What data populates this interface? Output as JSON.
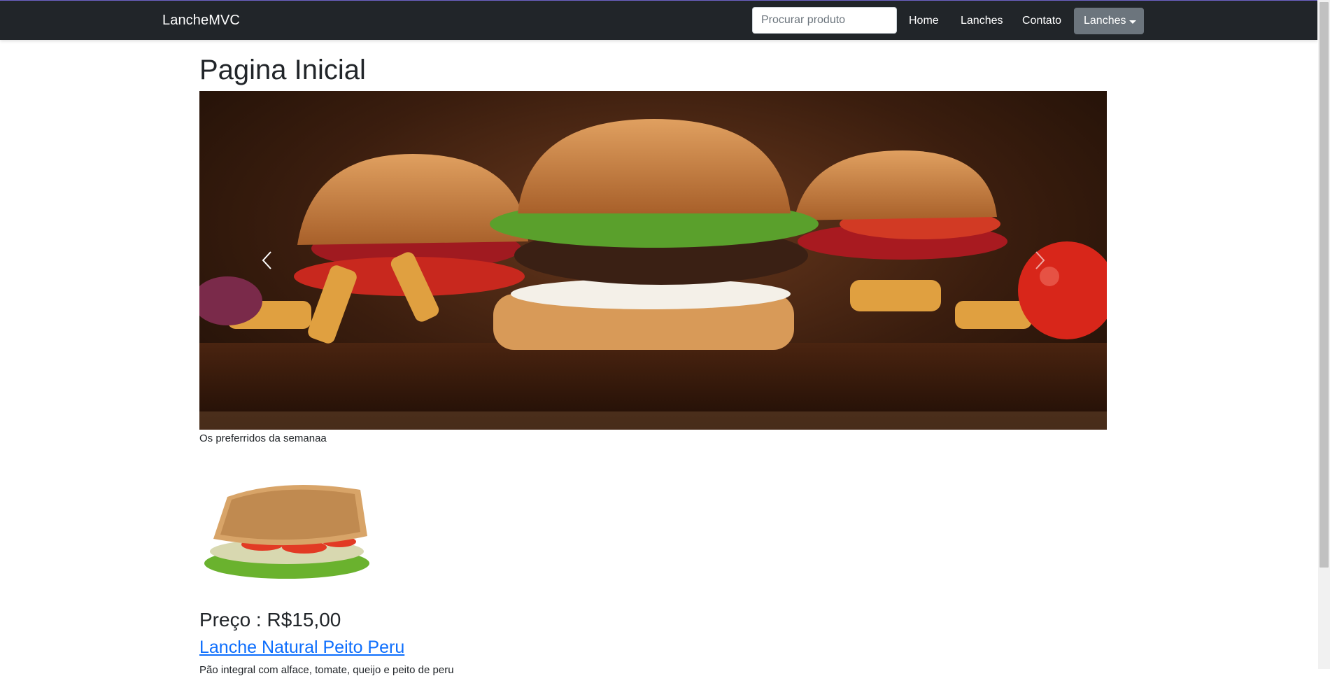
{
  "navbar": {
    "brand": "LancheMVC",
    "search_placeholder": "Procurar produto",
    "links": [
      "Home",
      "Lanches",
      "Contato"
    ],
    "dropdown_label": "Lanches"
  },
  "page": {
    "title": "Pagina Inicial",
    "carousel_caption": "Os preferridos da semanaa"
  },
  "product": {
    "price_text": "Preço : R$15,00",
    "name": "Lanche Natural Peito Peru",
    "description": "Pão integral com alface, tomate, queijo e peito de peru"
  },
  "icons": {
    "carousel_prev": "chevron-left-icon",
    "carousel_next": "chevron-right-icon",
    "dropdown": "caret-down-icon"
  },
  "colors": {
    "navbar_bg": "#212529",
    "dropdown_bg": "#6c757d",
    "link": "#0d6efd"
  }
}
